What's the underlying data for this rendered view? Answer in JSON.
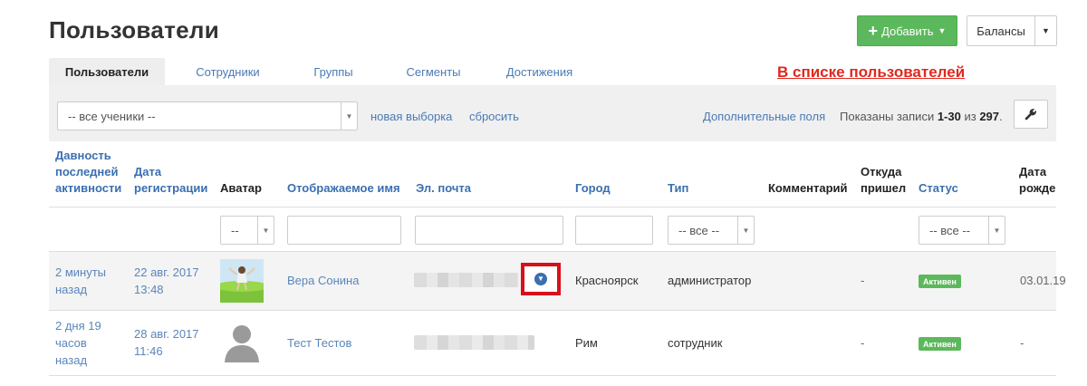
{
  "page": {
    "title": "Пользователи"
  },
  "header": {
    "add_button": "Добавить",
    "balances_button": "Балансы"
  },
  "tabs": [
    {
      "label": "Пользователи",
      "active": true
    },
    {
      "label": "Сотрудники"
    },
    {
      "label": "Группы"
    },
    {
      "label": "Сегменты"
    },
    {
      "label": "Достижения"
    }
  ],
  "annotation": "В списке пользователей",
  "filter": {
    "select_value": "-- все ученики --",
    "new_selection": "новая выборка",
    "reset": "сбросить",
    "extra_fields": "Дополнительные поля",
    "shown_prefix": "Показаны записи ",
    "shown_range": "1-30",
    "shown_middle": " из ",
    "shown_total": "297",
    "shown_suffix": "."
  },
  "columns": {
    "activity": [
      "Давность",
      "последней",
      "активности"
    ],
    "registered": [
      "Дата",
      "регистрации"
    ],
    "avatar": "Аватар",
    "display_name": "Отображаемое имя",
    "email": "Эл. почта",
    "city": "Город",
    "type": "Тип",
    "comment": "Комментарий",
    "source": [
      "Откуда",
      "пришел"
    ],
    "status": "Статус",
    "birthdate": [
      "Дата",
      "рожде"
    ]
  },
  "column_filters": {
    "avatar_select": "--",
    "type_select": "-- все --",
    "status_select": "-- все --"
  },
  "rows": [
    {
      "activity": [
        "2 минуты",
        "назад"
      ],
      "registered": [
        "22 авг. 2017",
        "13:48"
      ],
      "name": "Вера Сонина",
      "city": "Красноярск",
      "type": "администратор",
      "source": "-",
      "status": "Активен",
      "birthdate": "03.01.19"
    },
    {
      "activity": [
        "2 дня 19",
        "часов",
        "назад"
      ],
      "registered": [
        "28 авг. 2017",
        "11:46"
      ],
      "name": "Тест Тестов",
      "city": "Рим",
      "type": "сотрудник",
      "source": "-",
      "status": "Активен",
      "birthdate": "-"
    }
  ],
  "colors": {
    "accent_green": "#5cb85c",
    "link_blue": "#4a7ab5",
    "highlight_red": "#d8101a"
  }
}
